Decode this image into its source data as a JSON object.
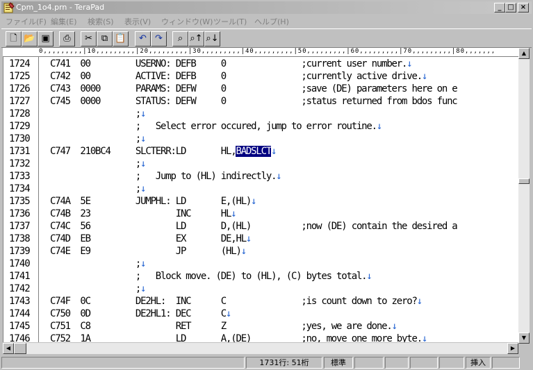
{
  "window": {
    "title": "Cpm_1o4.prn - TeraPad"
  },
  "menu": [
    "ファイル(F)",
    "編集(E)",
    "検索(S)",
    "表示(V)",
    "ウィンドウ(W)",
    "ツール(T)",
    "ヘルプ(H)"
  ],
  "toolbar": {
    "new_icon": "new-file-icon",
    "open_icon": "open-folder-icon",
    "save_icon": "save-icon",
    "print_icon": "print-icon",
    "cut_icon": "cut-icon",
    "copy_icon": "copy-icon",
    "paste_icon": "paste-icon",
    "undo_icon": "undo-icon",
    "redo_icon": "redo-icon",
    "find_icon": "find-icon",
    "find_prev_icon": "find-prev-icon",
    "find_next_icon": "find-next-icon"
  },
  "ruler": {
    "text": "0,,,,,,,,,|10,,,,,,,,,|20,,,,,,,,,|30,,,,,,,,,|40,,,,,,,,,|50,,,,,,,,,|60,,,,,,,,,|70,,,,,,,,,|80,,,,,,,"
  },
  "editor": {
    "lines": [
      {
        "n": "1724",
        "text": "C741  00         USERNO: DEFB     0               ;current user number."
      },
      {
        "n": "1725",
        "text": "C742  00         ACTIVE: DEFB     0               ;currently active drive."
      },
      {
        "n": "1726",
        "text": "C743  0000       PARAMS: DEFW     0               ;save (DE) parameters here on e"
      },
      {
        "n": "1727",
        "text": "C745  0000       STATUS: DEFW     0               ;status returned from bdos func"
      },
      {
        "n": "1728",
        "text": "                 ;"
      },
      {
        "n": "1729",
        "text": "                 ;   Select error occured, jump to error routine."
      },
      {
        "n": "1730",
        "text": "                 ;"
      },
      {
        "n": "1731",
        "text": "C747  210BC4     SLCTERR:LD       HL,",
        "sel": "BADSLCT"
      },
      {
        "n": "1732",
        "text": "                 ;"
      },
      {
        "n": "1733",
        "text": "                 ;   Jump to (HL) indirectly."
      },
      {
        "n": "1734",
        "text": "                 ;"
      },
      {
        "n": "1735",
        "text": "C74A  5E         JUMPHL: LD       E,(HL)"
      },
      {
        "n": "1736",
        "text": "C74B  23                 INC      HL"
      },
      {
        "n": "1737",
        "text": "C74C  56                 LD       D,(HL)          ;now (DE) contain the desired a"
      },
      {
        "n": "1738",
        "text": "C74D  EB                 EX       DE,HL"
      },
      {
        "n": "1739",
        "text": "C74E  E9                 JP       (HL)"
      },
      {
        "n": "1740",
        "text": "                 ;"
      },
      {
        "n": "1741",
        "text": "                 ;   Block move. (DE) to (HL), (C) bytes total."
      },
      {
        "n": "1742",
        "text": "                 ;"
      },
      {
        "n": "1743",
        "text": "C74F  0C         DE2HL:  INC      C               ;is count down to zero?"
      },
      {
        "n": "1744",
        "text": "C750  0D         DE2HL1: DEC      C"
      },
      {
        "n": "1745",
        "text": "C751  C8                 RET      Z               ;yes, we are done."
      },
      {
        "n": "1746",
        "text": "C752  1A                 LD       A,(DE)          ;no, move one more byte."
      }
    ],
    "ret_marks": [
      true,
      true,
      false,
      false,
      true,
      true,
      true,
      true,
      true,
      true,
      true,
      true,
      true,
      false,
      true,
      true,
      true,
      true,
      true,
      true,
      true,
      true,
      true
    ]
  },
  "status": {
    "position": "1731行:  51桁",
    "mode": "標準",
    "insert": "挿入"
  }
}
